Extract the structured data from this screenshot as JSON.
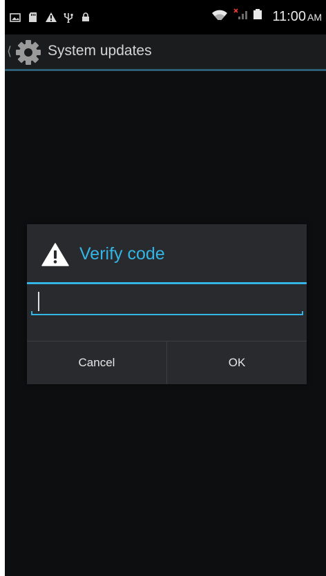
{
  "status_bar": {
    "time": "11:00",
    "ampm": "AM",
    "left_icons": [
      "picture-icon",
      "sd-card-icon",
      "alert-icon",
      "usb-icon",
      "lock-icon"
    ],
    "right_icons": [
      "wifi-icon",
      "signal-no-sim-icon",
      "battery-icon"
    ]
  },
  "action_bar": {
    "title": "System updates",
    "icon": "settings-gear-icon"
  },
  "dialog": {
    "title": "Verify code",
    "icon": "warning-icon",
    "input": {
      "value": "",
      "placeholder": ""
    },
    "cancel_label": "Cancel",
    "ok_label": "OK"
  },
  "colors": {
    "accent": "#33b5e5",
    "background": "#0c0e10",
    "dialog_background": "#282a2d",
    "status_bar": "#000000"
  }
}
